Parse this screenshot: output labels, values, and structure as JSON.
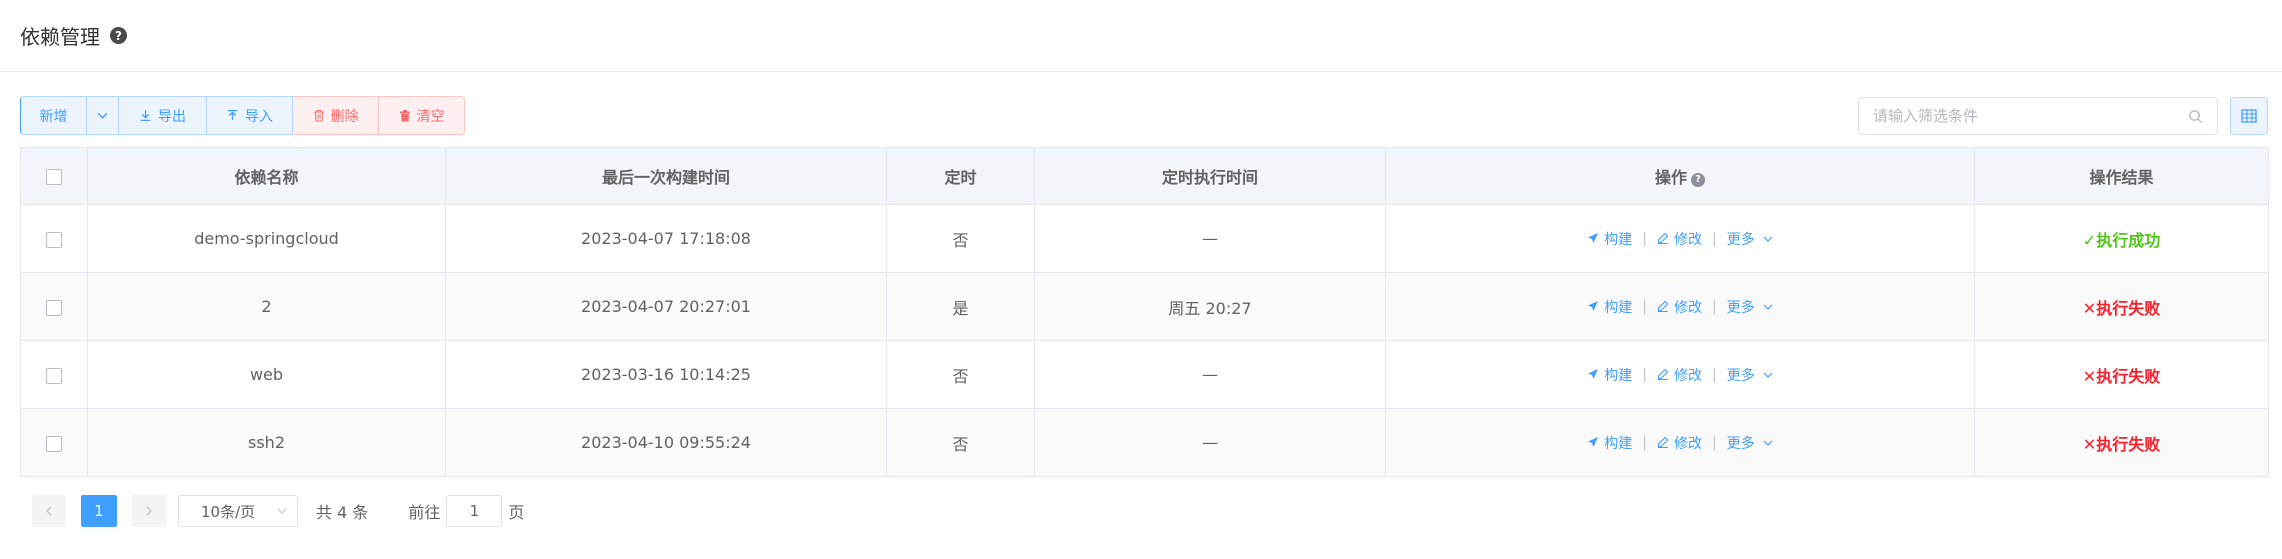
{
  "header": {
    "title": "依赖管理",
    "help": "?"
  },
  "toolbar": {
    "add_label": "新增",
    "add_dropdown_icon": "chevron-down-icon",
    "export_label": "导出",
    "import_label": "导入",
    "delete_label": "删除",
    "clear_label": "清空"
  },
  "search": {
    "placeholder": "请输入筛选条件"
  },
  "table": {
    "columns": [
      "依赖名称",
      "最后一次构建时间",
      "定时",
      "定时执行时间",
      "操作",
      "操作结果"
    ],
    "op_help": "?",
    "op_build": "构建",
    "op_edit": "修改",
    "op_more": "更多",
    "rows": [
      {
        "name": "demo-springcloud",
        "last_build": "2023-04-07 17:18:08",
        "timed": "否",
        "timed_time": "—",
        "result": "执行成功",
        "result_mark": "✓",
        "status": "success"
      },
      {
        "name": "2",
        "last_build": "2023-04-07 20:27:01",
        "timed": "是",
        "timed_time": "周五 20:27",
        "result": "执行失败",
        "result_mark": "✕",
        "status": "fail"
      },
      {
        "name": "web",
        "last_build": "2023-03-16 10:14:25",
        "timed": "否",
        "timed_time": "—",
        "result": "执行失败",
        "result_mark": "✕",
        "status": "fail"
      },
      {
        "name": "ssh2",
        "last_build": "2023-04-10 09:55:24",
        "timed": "否",
        "timed_time": "—",
        "result": "执行失败",
        "result_mark": "✕",
        "status": "fail"
      }
    ]
  },
  "pagination": {
    "current_page": "1",
    "page_size": "10条/页",
    "total": "共 4 条",
    "goto_label": "前往",
    "goto_value": "1",
    "page_suffix": "页"
  },
  "colors": {
    "primary": "#409eff",
    "success": "#52c41a",
    "danger": "#f5222d",
    "danger_btn": "#f56c6c"
  }
}
